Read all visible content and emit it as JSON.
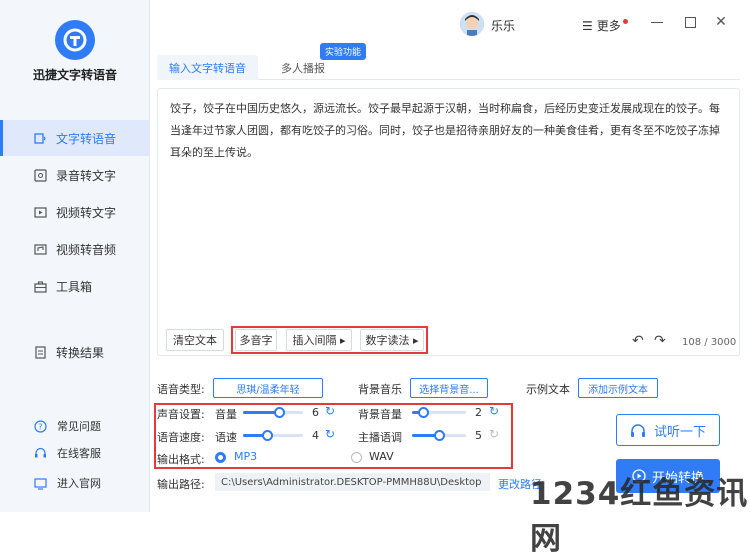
{
  "app": {
    "name": "迅捷文字转语音"
  },
  "sidebar": {
    "items": [
      {
        "label": "文字转语音",
        "icon": "text-to-speech-icon"
      },
      {
        "label": "录音转文字",
        "icon": "recording-icon"
      },
      {
        "label": "视频转文字",
        "icon": "video-icon"
      },
      {
        "label": "视频转音频",
        "icon": "video-audio-icon"
      },
      {
        "label": "工具箱",
        "icon": "toolbox-icon"
      },
      {
        "label": "转换结果",
        "icon": "result-icon"
      }
    ],
    "footer": [
      {
        "label": "常见问题",
        "icon": "help-icon"
      },
      {
        "label": "在线客服",
        "icon": "headset-icon"
      },
      {
        "label": "进入官网",
        "icon": "website-icon"
      }
    ]
  },
  "topbar": {
    "username": "乐乐",
    "more_label": "更多"
  },
  "tabs": [
    {
      "label": "输入文字转语音"
    },
    {
      "label": "多人播报"
    }
  ],
  "tab_badge": "实验功能",
  "editor": {
    "text": "饺子，饺子在中国历史悠久，源远流长。饺子最早起源于汉朝，当时称扁食，后经历史变迁发展成现在的饺子。每当逢年过节家人团圆，都有吃饺子的习俗。同时，饺子也是招待亲朋好友的一种美食佳肴，更有冬至不吃饺子冻掉耳朵的至上传说。",
    "clear_label": "清空文本",
    "polyphone_label": "多音字",
    "pause_label": "插入间隔 ▸",
    "number_label": "数字读法 ▸",
    "counter": "108 / 3000"
  },
  "settings": {
    "voice_type_label": "语音类型:",
    "voice_type_value": "思琪/温柔年轻",
    "bgm_label": "背景音乐",
    "bgm_value": "选择背景音...",
    "sample_label": "示例文本",
    "sample_value": "添加示例文本",
    "sound_settings_label": "声音设置:",
    "volume_label": "音量",
    "volume_value": "6",
    "bg_volume_label": "背景音量",
    "bg_volume_value": "2",
    "speed_settings_label": "语音速度:",
    "rate_label": "语速",
    "rate_value": "4",
    "tone_label": "主播语调",
    "tone_value": "5",
    "format_label": "输出格式:",
    "format_mp3": "MP3",
    "format_wav": "WAV",
    "path_label": "输出路径:",
    "path_value": "C:\\Users\\Administrator.DESKTOP-PMMH88U\\Desktop",
    "change_path": "更改路径"
  },
  "slider_levels": {
    "volume": 0.6,
    "bg_volume": 0.2,
    "rate": 0.4,
    "tone": 0.5
  },
  "actions": {
    "listen": "试听一下",
    "start": "开始转换"
  },
  "watermark": "1234红鱼资讯网",
  "colors": {
    "accent": "#2f7cf6",
    "highlight": "#e23b3b"
  }
}
